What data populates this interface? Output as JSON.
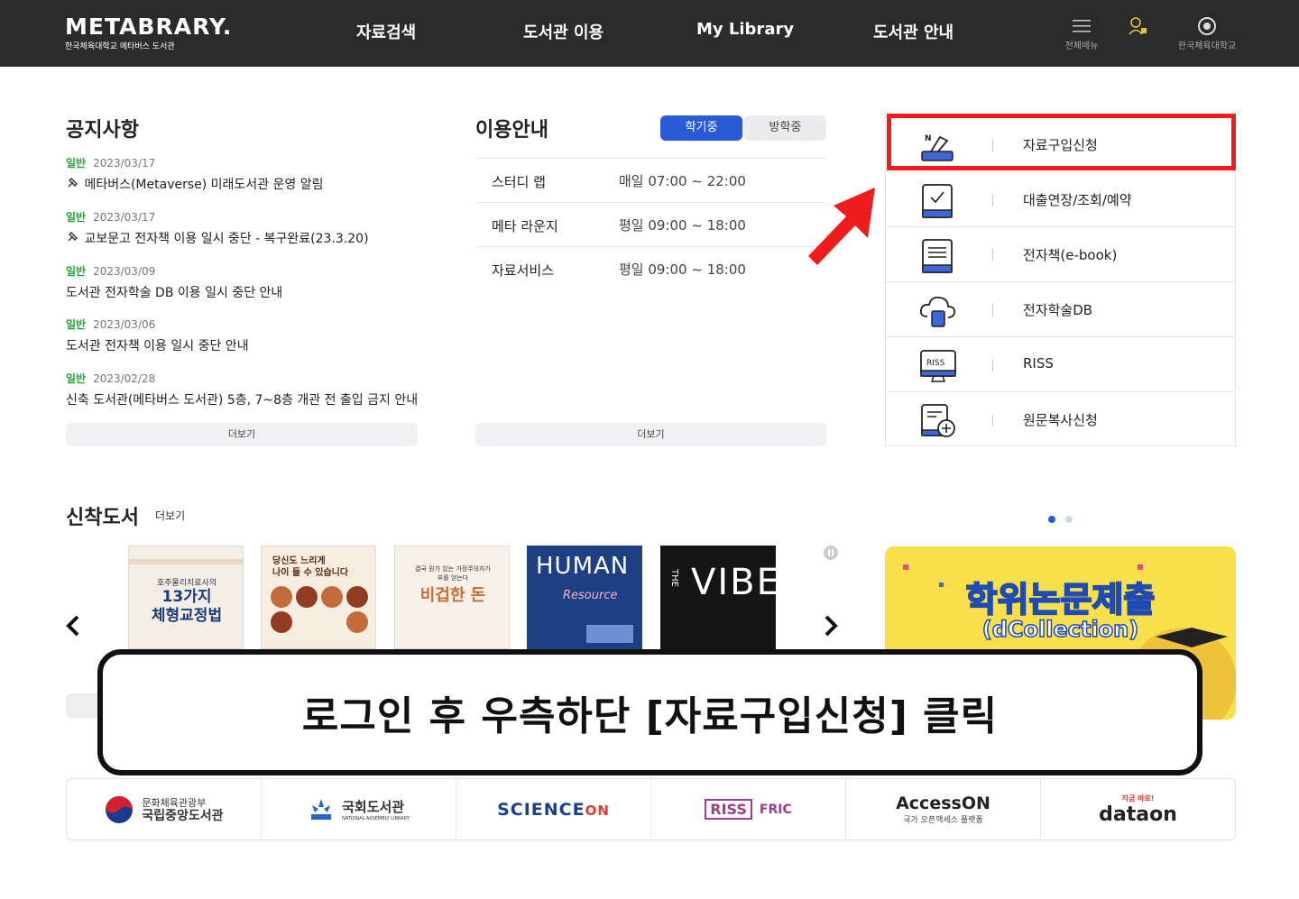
{
  "header": {
    "logo": "METABRARY.",
    "logo_sub": "한국체육대학교 메타버스 도서관",
    "nav": [
      "자료검색",
      "도서관 이용",
      "My Library",
      "도서관 안내"
    ],
    "icons": [
      {
        "icon": "menu-icon",
        "label": "전체메뉴"
      },
      {
        "icon": "user-icon",
        "label": ""
      },
      {
        "icon": "university-emblem-icon",
        "label": "한국체육대학교"
      }
    ]
  },
  "notices": {
    "title": "공지사항",
    "items": [
      {
        "category": "일반",
        "date": "2023/03/17",
        "title": "메타버스(Metaverse) 미래도서관 운영 알림",
        "pinned": true
      },
      {
        "category": "일반",
        "date": "2023/03/17",
        "title": "교보문고 전자책 이용 일시 중단 - 복구완료(23.3.20)",
        "pinned": true
      },
      {
        "category": "일반",
        "date": "2023/03/09",
        "title": "도서관 전자학술 DB 이용 일시 중단 안내",
        "pinned": false
      },
      {
        "category": "일반",
        "date": "2023/03/06",
        "title": "도서관 전자책 이용 일시 중단 안내",
        "pinned": false
      },
      {
        "category": "일반",
        "date": "2023/02/28",
        "title": "신축 도서관(메타버스 도서관) 5층, 7~8층 개관 전 출입 금지 안내",
        "pinned": false
      }
    ],
    "more": "더보기"
  },
  "usage": {
    "title": "이용안내",
    "tabs": [
      "학기중",
      "방학중"
    ],
    "rows": [
      {
        "label": "스터디 랩",
        "value": "매일 07:00 ~ 22:00"
      },
      {
        "label": "메타 라운지",
        "value": "평일 09:00 ~ 18:00"
      },
      {
        "label": "자료서비스",
        "value": "평일 09:00 ~ 18:00"
      }
    ],
    "more": "더보기"
  },
  "quick_menu": [
    {
      "icon": "book-request-icon",
      "label": "자료구입신청"
    },
    {
      "icon": "loan-check-icon",
      "label": "대출연장/조회/예약"
    },
    {
      "icon": "ebook-icon",
      "label": "전자책(e-book)"
    },
    {
      "icon": "cloud-db-icon",
      "label": "전자학술DB"
    },
    {
      "icon": "riss-monitor-icon",
      "label": "RISS"
    },
    {
      "icon": "document-add-icon",
      "label": "원문복사신청"
    }
  ],
  "new_books": {
    "title": "신착도서",
    "more": "더보기",
    "books": [
      {
        "top": "",
        "main": "13가지\n체형교정법",
        "sub": "호주물리치료사의",
        "bg": "#f4efe6",
        "fg": "#1b3a7a"
      },
      {
        "top": "당신도 느리게\n나이 들 수 있습니다",
        "main": "",
        "sub": "",
        "bg": "#f6ece0",
        "fg": "#5b2a18"
      },
      {
        "top": "결국 원가 있는 가정주의자가\n부를 얻는다",
        "main": "비겁한 돈",
        "sub": "",
        "bg": "#f7f1e9",
        "fg": "#c96a3a"
      },
      {
        "top": "",
        "main": "HUMAN",
        "sub": "Resource",
        "bg": "#1f3f84",
        "fg": "#ffffff"
      },
      {
        "top": "",
        "main": "VIBE",
        "sub": "THE",
        "bg": "#151515",
        "fg": "#ffffff"
      }
    ]
  },
  "banner": {
    "title": "학위논문제출",
    "subtitle": "(dCollection)"
  },
  "callout": "로그인 후 우측하단 [자료구입신청] 클릭",
  "partners": [
    {
      "icon": "nlk-logo-icon",
      "line1": "문화체육관광부",
      "line2": "국립중앙도서관"
    },
    {
      "icon": "nanet-logo-icon",
      "line1": "국회도서관",
      "line2": "NATIONAL ASSEMBLY LIBRARY"
    },
    {
      "icon": "scienceon-logo-icon",
      "line1": "SCIENCE",
      "line2": "ON"
    },
    {
      "icon": "riss-fric-logo-icon",
      "line1": "RISS",
      "line2": "FRIC"
    },
    {
      "icon": "accesson-logo-icon",
      "line1": "AccessON",
      "line2": "국가 오픈액세스 플랫폼"
    },
    {
      "icon": "dataon-logo-icon",
      "line1": "지금 바로!",
      "line2": "dataon"
    }
  ],
  "colors": {
    "header_bg": "#2b2b2b",
    "tab_active": "#2a5bd7",
    "notice_category": "#2aa136",
    "highlight": "#ee1c1c",
    "banner_bg": "#f8e04a"
  }
}
